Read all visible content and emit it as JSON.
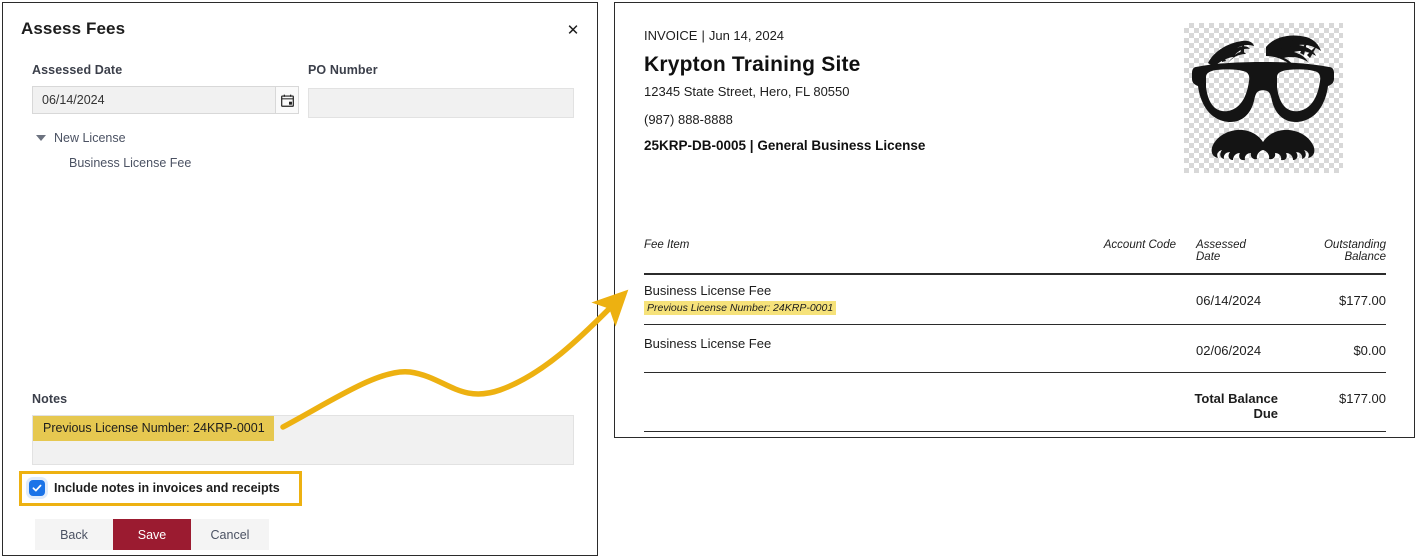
{
  "dialog": {
    "title": "Assess Fees",
    "close_icon": "close-icon",
    "assessed_date": {
      "label": "Assessed Date",
      "value": "06/14/2024",
      "calendar_icon": "calendar-icon"
    },
    "po_number": {
      "label": "PO Number",
      "value": "",
      "placeholder": ""
    },
    "tree": {
      "toggle_icon": "chevron-down-icon",
      "parent": "New License",
      "child": "Business License Fee"
    },
    "notes": {
      "label": "Notes",
      "value": "Previous License Number: 24KRP-0001",
      "highlight_color": "#e6c850"
    },
    "include_notes_checkbox": {
      "label": "Include notes in invoices and receipts",
      "checked": true,
      "check_color": "#1a73e8",
      "callout_color": "#edb111"
    },
    "buttons": {
      "back": "Back",
      "save": "Save",
      "cancel": "Cancel",
      "save_color": "#9b1b30"
    }
  },
  "invoice": {
    "doc_type": "INVOICE",
    "separator": "|",
    "date": "Jun 14, 2024",
    "business_name": "Krypton Training Site",
    "address": "12345 State Street, Hero, FL 80550",
    "phone": "(987) 888-8888",
    "license_line": "25KRP-DB-0005 | General Business License",
    "logo_icon": "disguise-glasses-mustache-logo",
    "table": {
      "headers": {
        "fee_item": "Fee Item",
        "account_code": "Account Code",
        "assessed_date": "Assessed\nDate",
        "assessed_date_line1": "Assessed",
        "assessed_date_line2": "Date",
        "outstanding_balance_line1": "Outstanding",
        "outstanding_balance_line2": "Balance"
      },
      "rows": [
        {
          "fee_item": "Business License Fee",
          "note": "Previous License Number: 24KRP-0001",
          "account_code": "",
          "assessed_date": "06/14/2024",
          "outstanding_balance": "$177.00"
        },
        {
          "fee_item": "Business License Fee",
          "note": "",
          "account_code": "",
          "assessed_date": "02/06/2024",
          "outstanding_balance": "$0.00"
        }
      ],
      "total_label": "Total Balance Due",
      "total_value": "$177.00",
      "note_highlight_color": "#f6e27a"
    }
  },
  "annotation": {
    "arrow_color": "#edb111",
    "arrow_name": "callout-arrow"
  }
}
